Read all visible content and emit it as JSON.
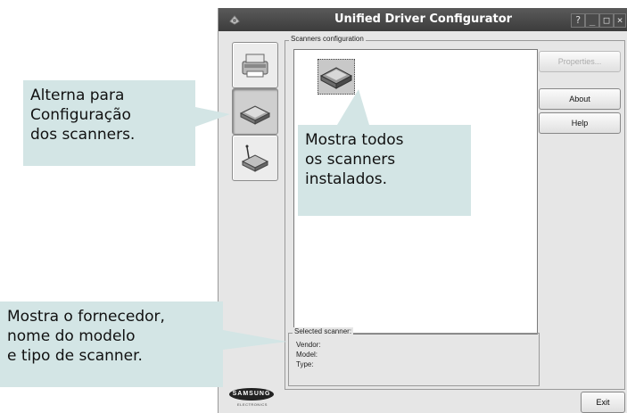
{
  "window": {
    "title": "Unified Driver Configurator",
    "controls": {
      "help": "?",
      "minimize": "_",
      "maximize": "□",
      "close": "×"
    }
  },
  "sidebar": {
    "items": [
      {
        "icon": "printer-icon",
        "active": false
      },
      {
        "icon": "scanner-icon",
        "active": true
      },
      {
        "icon": "port-icon",
        "active": false
      }
    ]
  },
  "scanners": {
    "group_label": "Scanners configuration",
    "list": [
      {
        "icon": "scanner-icon",
        "selected": true
      }
    ]
  },
  "selected_scanner": {
    "group_label": "Selected scanner:",
    "vendor_label": "Vendor:",
    "model_label": "Model:",
    "type_label": "Type:"
  },
  "buttons": {
    "properties": "Properties...",
    "about": "About",
    "help": "Help",
    "exit": "Exit"
  },
  "logo": {
    "brand": "SAMSUNG",
    "sub": "ELECTRONICS"
  },
  "callouts": {
    "switch": {
      "line1": "Alterna para",
      "line2": "Configuração",
      "line3": "dos scanners."
    },
    "list": {
      "line1": "Mostra todos",
      "line2": "os scanners",
      "line3": "instalados."
    },
    "info": {
      "line1": "Mostra o fornecedor,",
      "line2": "nome do modelo",
      "line3": "e tipo de scanner."
    }
  },
  "colors": {
    "callout_bg": "#d3e5e5",
    "titlebar": "#474747",
    "window_bg": "#e6e6e6"
  }
}
